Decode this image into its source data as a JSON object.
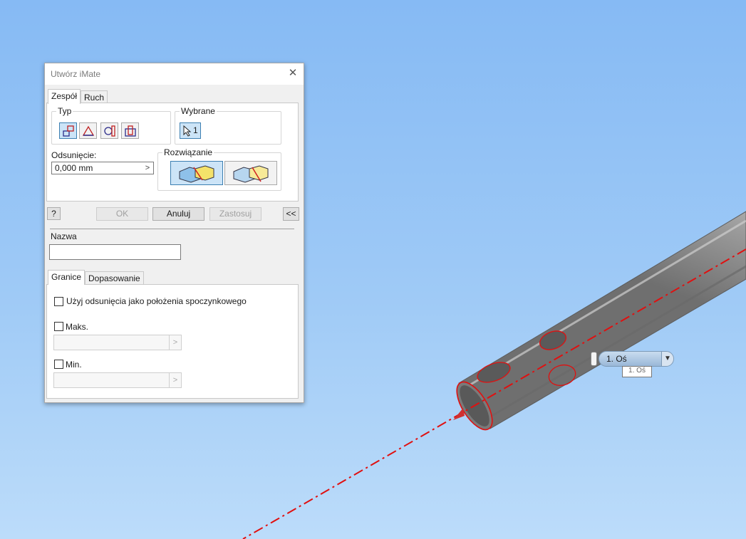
{
  "dialog": {
    "title": "Utwórz iMate",
    "close_glyph": "✕",
    "tabs": [
      "Zespół",
      "Ruch"
    ],
    "active_tab": "Zespół",
    "type_group": {
      "label": "Typ",
      "buttons": [
        "mate-icon",
        "angle-icon",
        "tangent-icon",
        "insert-icon"
      ]
    },
    "selected_group": {
      "label": "Wybrane",
      "count": "1"
    },
    "offset": {
      "label": "Odsunięcie:",
      "value": "0,000 mm",
      "arrow": ">"
    },
    "solution_group": {
      "label": "Rozwiązanie",
      "buttons": [
        "mate-solution-icon",
        "flush-solution-icon"
      ]
    },
    "help_glyph": "?",
    "buttons": {
      "ok": "OK",
      "cancel": "Anuluj",
      "apply": "Zastosuj",
      "collapse": "<<"
    },
    "name": {
      "label": "Nazwa",
      "value": ""
    },
    "lower_tabs": [
      "Granice",
      "Dopasowanie"
    ],
    "active_lower_tab": "Granice",
    "limits": {
      "use_offset_label": "Użyj odsunięcia jako położenia spoczynkowego",
      "max_label": "Maks.",
      "min_label": "Min.",
      "field_arrow": ">"
    }
  },
  "viewport": {
    "axis_selector": "1. Oś",
    "axis_tooltip": "1. Oś",
    "background_top": "#86baf4",
    "background_bottom": "#bcdcfa",
    "highlight_color": "#e01010"
  }
}
